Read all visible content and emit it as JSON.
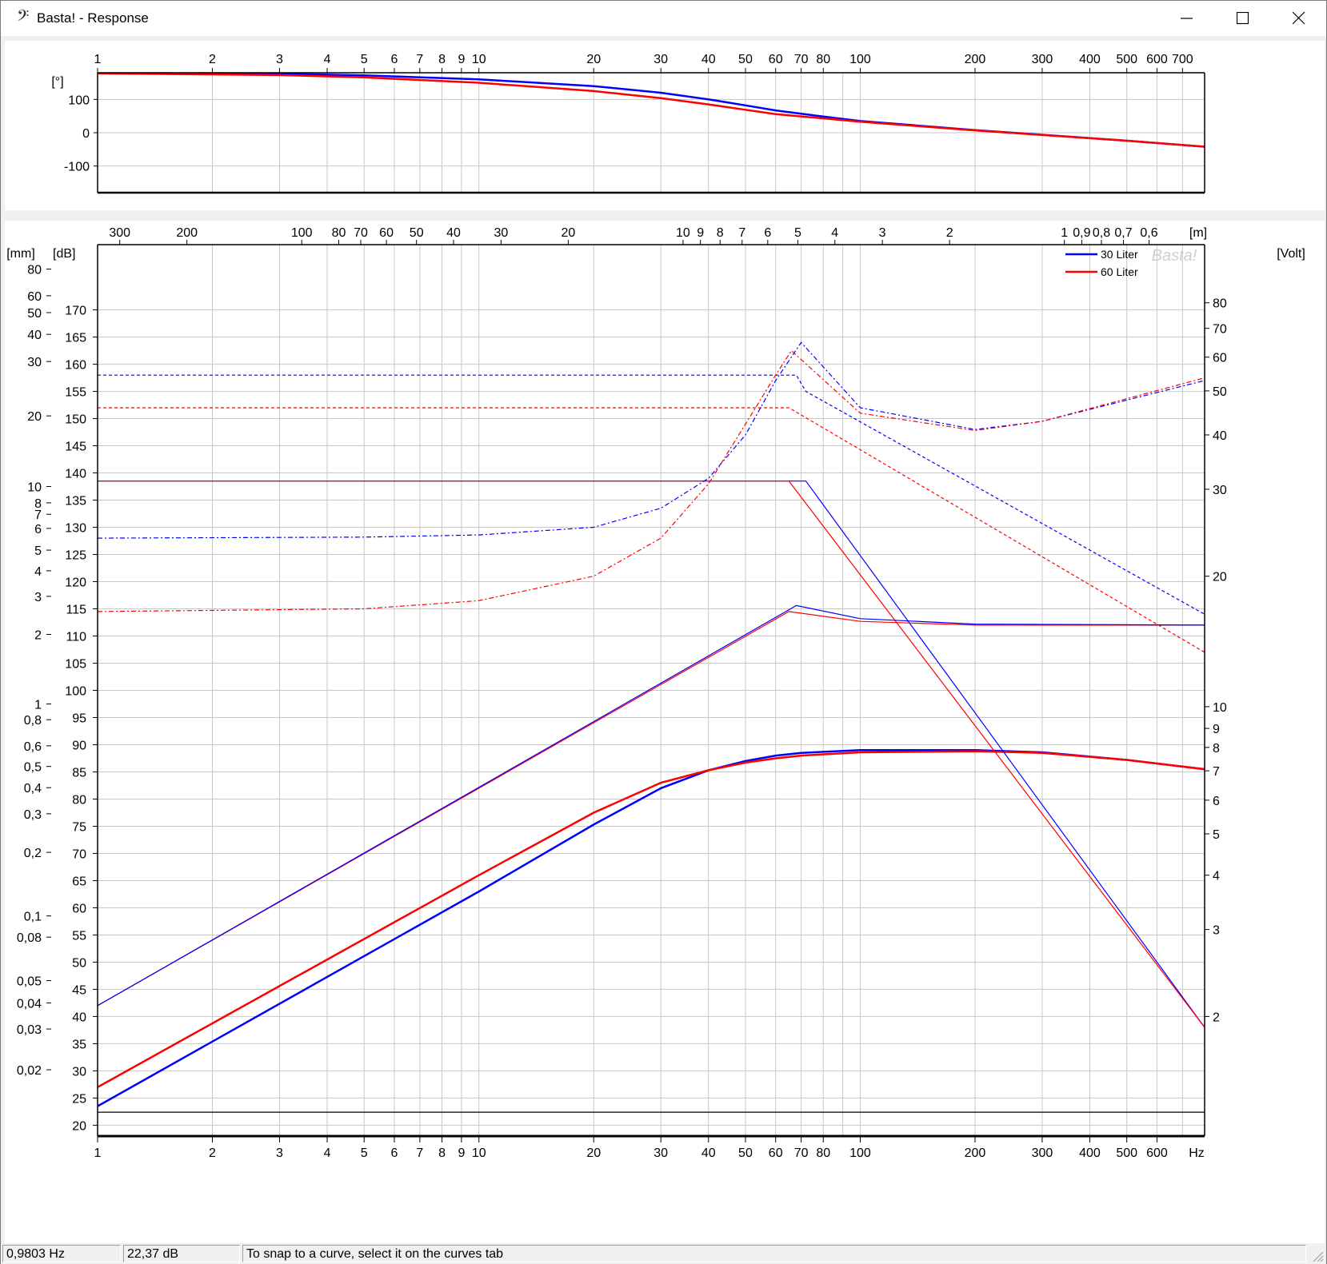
{
  "window": {
    "title": "Basta! - Response",
    "icon": "bass-clef-icon"
  },
  "status": {
    "frequency": "0,9803 Hz",
    "level": "22,37 dB",
    "hint": "To snap to a curve, select it on the curves tab"
  },
  "colors": {
    "series_a": "#0000ff",
    "series_b": "#ff0000",
    "grid": "#c8c8c8"
  },
  "chart_data": [
    {
      "type": "line",
      "name": "phase",
      "xscale": "log",
      "xlim": [
        1,
        800
      ],
      "ylim": [
        -180,
        180
      ],
      "ylabel": "[°]",
      "x_ticks": [
        {
          "v": 1,
          "t": "1"
        },
        {
          "v": 2,
          "t": "2"
        },
        {
          "v": 3,
          "t": "3"
        },
        {
          "v": 4,
          "t": "4"
        },
        {
          "v": 5,
          "t": "5"
        },
        {
          "v": 6,
          "t": "6"
        },
        {
          "v": 7,
          "t": "7"
        },
        {
          "v": 8,
          "t": "8"
        },
        {
          "v": 9,
          "t": "9"
        },
        {
          "v": 10,
          "t": "10"
        },
        {
          "v": 20,
          "t": "20"
        },
        {
          "v": 30,
          "t": "30"
        },
        {
          "v": 40,
          "t": "40"
        },
        {
          "v": 50,
          "t": "50"
        },
        {
          "v": 60,
          "t": "60"
        },
        {
          "v": 70,
          "t": "70"
        },
        {
          "v": 80,
          "t": "80"
        },
        {
          "v": 100,
          "t": "100"
        },
        {
          "v": 200,
          "t": "200"
        },
        {
          "v": 300,
          "t": "300"
        },
        {
          "v": 400,
          "t": "400"
        },
        {
          "v": 500,
          "t": "500"
        },
        {
          "v": 600,
          "t": "600"
        },
        {
          "v": 700,
          "t": "700"
        }
      ],
      "y_ticks": [
        {
          "v": 100,
          "t": "100"
        },
        {
          "v": 0,
          "t": "0"
        },
        {
          "v": -100,
          "t": "-100"
        }
      ],
      "series": [
        {
          "name": "30 Liter",
          "color": "#0000ff",
          "width": 2.5,
          "dash": "",
          "points": [
            [
              1,
              178
            ],
            [
              3,
              177
            ],
            [
              5,
              172
            ],
            [
              10,
              160
            ],
            [
              20,
              140
            ],
            [
              30,
              120
            ],
            [
              40,
              100
            ],
            [
              50,
              82
            ],
            [
              60,
              67
            ],
            [
              70,
              57
            ],
            [
              100,
              35
            ],
            [
              200,
              8
            ],
            [
              500,
              -24
            ],
            [
              800,
              -42
            ]
          ]
        },
        {
          "name": "60 Liter",
          "color": "#ff0000",
          "width": 2.5,
          "dash": "",
          "points": [
            [
              1,
              178
            ],
            [
              3,
              173
            ],
            [
              5,
              166
            ],
            [
              10,
              150
            ],
            [
              20,
              125
            ],
            [
              30,
              104
            ],
            [
              40,
              85
            ],
            [
              50,
              69
            ],
            [
              60,
              56
            ],
            [
              70,
              49
            ],
            [
              100,
              33
            ],
            [
              200,
              7
            ],
            [
              500,
              -24
            ],
            [
              800,
              -42
            ]
          ]
        }
      ]
    },
    {
      "type": "line",
      "name": "response",
      "xscale": "log",
      "xlim": [
        1,
        800
      ],
      "ylim": [
        18,
        182
      ],
      "ylabel": "[dB]",
      "xlabel": "Hz",
      "legend": "top-right",
      "watermark": "Basta!",
      "x_ticks": [
        {
          "v": 1,
          "t": "1"
        },
        {
          "v": 2,
          "t": "2"
        },
        {
          "v": 3,
          "t": "3"
        },
        {
          "v": 4,
          "t": "4"
        },
        {
          "v": 5,
          "t": "5"
        },
        {
          "v": 6,
          "t": "6"
        },
        {
          "v": 7,
          "t": "7"
        },
        {
          "v": 8,
          "t": "8"
        },
        {
          "v": 9,
          "t": "9"
        },
        {
          "v": 10,
          "t": "10"
        },
        {
          "v": 20,
          "t": "20"
        },
        {
          "v": 30,
          "t": "30"
        },
        {
          "v": 40,
          "t": "40"
        },
        {
          "v": 50,
          "t": "50"
        },
        {
          "v": 60,
          "t": "60"
        },
        {
          "v": 70,
          "t": "70"
        },
        {
          "v": 80,
          "t": "80"
        },
        {
          "v": 100,
          "t": "100"
        },
        {
          "v": 200,
          "t": "200"
        },
        {
          "v": 300,
          "t": "300"
        },
        {
          "v": 400,
          "t": "400"
        },
        {
          "v": 500,
          "t": "500"
        },
        {
          "v": 600,
          "t": "600"
        }
      ],
      "y_ticks": [
        {
          "v": 20,
          "t": "20"
        },
        {
          "v": 25,
          "t": "25"
        },
        {
          "v": 30,
          "t": "30"
        },
        {
          "v": 35,
          "t": "35"
        },
        {
          "v": 40,
          "t": "40"
        },
        {
          "v": 45,
          "t": "45"
        },
        {
          "v": 50,
          "t": "50"
        },
        {
          "v": 55,
          "t": "55"
        },
        {
          "v": 60,
          "t": "60"
        },
        {
          "v": 65,
          "t": "65"
        },
        {
          "v": 70,
          "t": "70"
        },
        {
          "v": 75,
          "t": "75"
        },
        {
          "v": 80,
          "t": "80"
        },
        {
          "v": 85,
          "t": "85"
        },
        {
          "v": 90,
          "t": "90"
        },
        {
          "v": 95,
          "t": "95"
        },
        {
          "v": 100,
          "t": "100"
        },
        {
          "v": 105,
          "t": "105"
        },
        {
          "v": 110,
          "t": "110"
        },
        {
          "v": 115,
          "t": "115"
        },
        {
          "v": 120,
          "t": "120"
        },
        {
          "v": 125,
          "t": "125"
        },
        {
          "v": 130,
          "t": "130"
        },
        {
          "v": 135,
          "t": "135"
        },
        {
          "v": 140,
          "t": "140"
        },
        {
          "v": 145,
          "t": "145"
        },
        {
          "v": 150,
          "t": "150"
        },
        {
          "v": 155,
          "t": "155"
        },
        {
          "v": 160,
          "t": "160"
        },
        {
          "v": 165,
          "t": "165"
        },
        {
          "v": 170,
          "t": "170"
        }
      ],
      "top_axis": {
        "unit": "[m]",
        "ticks": [
          {
            "f": 1.143,
            "t": "300"
          },
          {
            "f": 1.715,
            "t": "200"
          },
          {
            "f": 3.43,
            "t": "100"
          },
          {
            "f": 4.29,
            "t": "80"
          },
          {
            "f": 4.9,
            "t": "70"
          },
          {
            "f": 5.72,
            "t": "60"
          },
          {
            "f": 6.86,
            "t": "50"
          },
          {
            "f": 8.58,
            "t": "40"
          },
          {
            "f": 11.43,
            "t": "30"
          },
          {
            "f": 17.15,
            "t": "20"
          },
          {
            "f": 34.3,
            "t": "10"
          },
          {
            "f": 38.1,
            "t": "9"
          },
          {
            "f": 42.9,
            "t": "8"
          },
          {
            "f": 49,
            "t": "7"
          },
          {
            "f": 57.2,
            "t": "6"
          },
          {
            "f": 68.6,
            "t": "5"
          },
          {
            "f": 85.8,
            "t": "4"
          },
          {
            "f": 114.3,
            "t": "3"
          },
          {
            "f": 171.5,
            "t": "2"
          },
          {
            "f": 343,
            "t": "1"
          },
          {
            "f": 381,
            "t": "0,9"
          },
          {
            "f": 429,
            "t": "0,8"
          },
          {
            "f": 490,
            "t": "0,7"
          },
          {
            "f": 572,
            "t": "0,6"
          }
        ]
      },
      "left_axis": {
        "unit": "[mm]",
        "ticks": [
          {
            "y": 177.5,
            "t": "80"
          },
          {
            "y": 172.6,
            "t": "60"
          },
          {
            "y": 169.5,
            "t": "50"
          },
          {
            "y": 165.5,
            "t": "40"
          },
          {
            "y": 160.5,
            "t": "30"
          },
          {
            "y": 150.5,
            "t": "20"
          },
          {
            "y": 137.5,
            "t": "10"
          },
          {
            "y": 134.5,
            "t": "8"
          },
          {
            "y": 132.4,
            "t": "7"
          },
          {
            "y": 129.8,
            "t": "6"
          },
          {
            "y": 125.8,
            "t": "5"
          },
          {
            "y": 122,
            "t": "4"
          },
          {
            "y": 117.3,
            "t": "3"
          },
          {
            "y": 110.3,
            "t": "2"
          },
          {
            "y": 97.5,
            "t": "1"
          },
          {
            "y": 94.6,
            "t": "0,8"
          },
          {
            "y": 89.8,
            "t": "0,6"
          },
          {
            "y": 86,
            "t": "0,5"
          },
          {
            "y": 82.1,
            "t": "0,4"
          },
          {
            "y": 77.3,
            "t": "0,3"
          },
          {
            "y": 70.2,
            "t": "0,2"
          },
          {
            "y": 58.5,
            "t": "0,1"
          },
          {
            "y": 54.6,
            "t": "0,08"
          },
          {
            "y": 46.6,
            "t": "0,05"
          },
          {
            "y": 42.5,
            "t": "0,04"
          },
          {
            "y": 37.7,
            "t": "0,03"
          },
          {
            "y": 30.2,
            "t": "0,02"
          }
        ]
      },
      "right_axis": {
        "unit": "[Volt]",
        "ticks": [
          {
            "y": 171.3,
            "t": "80"
          },
          {
            "y": 166.6,
            "t": "70"
          },
          {
            "y": 161.3,
            "t": "60"
          },
          {
            "y": 155.1,
            "t": "50"
          },
          {
            "y": 147,
            "t": "40"
          },
          {
            "y": 137,
            "t": "30"
          },
          {
            "y": 121,
            "t": "20"
          },
          {
            "y": 97,
            "t": "10"
          },
          {
            "y": 93,
            "t": "9"
          },
          {
            "y": 89.5,
            "t": "8"
          },
          {
            "y": 85.2,
            "t": "7"
          },
          {
            "y": 79.8,
            "t": "6"
          },
          {
            "y": 73.6,
            "t": "5"
          },
          {
            "y": 66,
            "t": "4"
          },
          {
            "y": 56,
            "t": "3"
          },
          {
            "y": 40,
            "t": "2"
          }
        ]
      },
      "series": [
        {
          "name": "30 Liter",
          "legend": true,
          "color": "#0000ff",
          "width": 2.5,
          "dash": "",
          "points": [
            [
              1,
              23.5
            ],
            [
              10,
              63
            ],
            [
              20,
              75.3
            ],
            [
              30,
              82
            ],
            [
              40,
              85.3
            ],
            [
              50,
              87
            ],
            [
              60,
              88
            ],
            [
              70,
              88.5
            ],
            [
              100,
              89
            ],
            [
              200,
              89
            ],
            [
              300,
              88.6
            ],
            [
              500,
              87.2
            ],
            [
              800,
              85.5
            ]
          ]
        },
        {
          "name": "60 Liter",
          "legend": true,
          "color": "#ff0000",
          "width": 2.5,
          "dash": "",
          "points": [
            [
              1,
              27
            ],
            [
              10,
              66
            ],
            [
              20,
              77.5
            ],
            [
              30,
              83
            ],
            [
              40,
              85.3
            ],
            [
              50,
              86.7
            ],
            [
              60,
              87.5
            ],
            [
              70,
              88
            ],
            [
              100,
              88.6
            ],
            [
              200,
              88.8
            ],
            [
              300,
              88.5
            ],
            [
              500,
              87.2
            ],
            [
              800,
              85.5
            ]
          ]
        },
        {
          "color": "#0000ff",
          "width": 1.2,
          "dash": "",
          "points": [
            [
              1,
              138.5
            ],
            [
              68,
              138.5
            ],
            [
              72,
              138.5
            ],
            [
              800,
              38
            ]
          ]
        },
        {
          "color": "#ff0000",
          "width": 1.2,
          "dash": "",
          "points": [
            [
              1,
              138.5
            ],
            [
              65,
              138.5
            ],
            [
              800,
              38
            ]
          ]
        },
        {
          "color": "#ff0000",
          "width": 1.2,
          "dash": "",
          "points": [
            [
              1,
              42
            ],
            [
              65,
              114.5
            ],
            [
              100,
              112.7
            ],
            [
              200,
              112
            ],
            [
              800,
              112
            ]
          ]
        },
        {
          "color": "#0000ff",
          "width": 1.2,
          "dash": "",
          "points": [
            [
              1,
              42
            ],
            [
              68,
              115.6
            ],
            [
              100,
              113.2
            ],
            [
              200,
              112.2
            ],
            [
              800,
              112
            ]
          ]
        },
        {
          "color": "#0000ff",
          "width": 1.2,
          "dash": "4 3",
          "points": [
            [
              1,
              158
            ],
            [
              68,
              158
            ],
            [
              72,
              155
            ],
            [
              800,
              114
            ]
          ]
        },
        {
          "color": "#ff0000",
          "width": 1.2,
          "dash": "4 3",
          "points": [
            [
              1,
              152
            ],
            [
              65,
              152
            ],
            [
              800,
              107
            ]
          ]
        },
        {
          "color": "#0000ff",
          "width": 1.2,
          "dash": "6 3 2 3",
          "points": [
            [
              1,
              128
            ],
            [
              5,
              128.2
            ],
            [
              10,
              128.6
            ],
            [
              20,
              130
            ],
            [
              30,
              133.5
            ],
            [
              40,
              139
            ],
            [
              50,
              147
            ],
            [
              60,
              157
            ],
            [
              70,
              164
            ],
            [
              100,
              152
            ],
            [
              200,
              148
            ],
            [
              300,
              149.5
            ],
            [
              800,
              157
            ]
          ]
        },
        {
          "color": "#ff0000",
          "width": 1.2,
          "dash": "6 3 2 3",
          "points": [
            [
              1,
              114.5
            ],
            [
              5,
              115
            ],
            [
              10,
              116.5
            ],
            [
              20,
              121
            ],
            [
              30,
              128
            ],
            [
              40,
              138
            ],
            [
              50,
              149
            ],
            [
              60,
              158
            ],
            [
              66,
              162.5
            ],
            [
              100,
              151
            ],
            [
              200,
              147.8
            ],
            [
              300,
              149.5
            ],
            [
              800,
              157.5
            ]
          ]
        },
        {
          "color": "#000000",
          "width": 1.2,
          "dash": "",
          "points": [
            [
              1,
              22.4
            ],
            [
              800,
              22.4
            ]
          ]
        }
      ]
    }
  ]
}
